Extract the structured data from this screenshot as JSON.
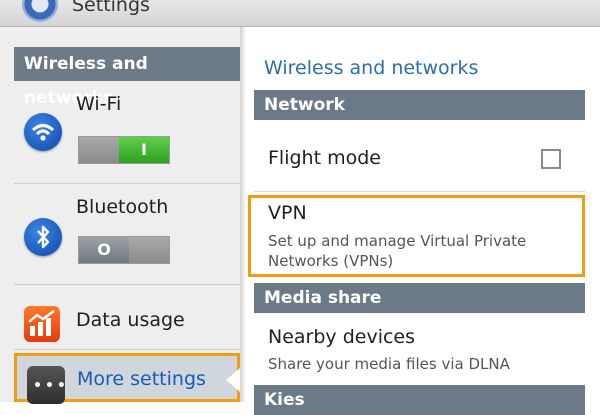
{
  "app": {
    "title": "Settings",
    "icon": "settings-gear-icon"
  },
  "sidebar": {
    "header": "Wireless and networks",
    "items": [
      {
        "label": "Wi-Fi",
        "icon": "wifi-icon",
        "toggle_state": "on",
        "toggle_glyph": "I"
      },
      {
        "label": "Bluetooth",
        "icon": "bluetooth-icon",
        "toggle_state": "off",
        "toggle_glyph": "O"
      },
      {
        "label": "Data usage",
        "icon": "data-usage-icon"
      },
      {
        "label": "More settings",
        "icon": "more-settings-icon",
        "selected": true,
        "dots": "•••"
      }
    ]
  },
  "main": {
    "title": "Wireless and networks",
    "sections": [
      {
        "header": "Network",
        "items": [
          {
            "title": "Flight mode",
            "checked": false
          },
          {
            "title": "VPN",
            "subtitle_line1": "Set up and manage Virtual Private",
            "subtitle_line2": "Networks (VPNs)"
          }
        ]
      },
      {
        "header": "Media share",
        "items": [
          {
            "title": "Nearby devices",
            "subtitle_line1": "Share your media files via DLNA"
          }
        ]
      },
      {
        "header": "Kies"
      }
    ]
  },
  "colors": {
    "category_bg": "#6c7a87",
    "highlight": "#f39b13",
    "title_blue": "#2c6fa8",
    "selected_text": "#1d59b5",
    "toggle_on": "#3cb52d"
  }
}
